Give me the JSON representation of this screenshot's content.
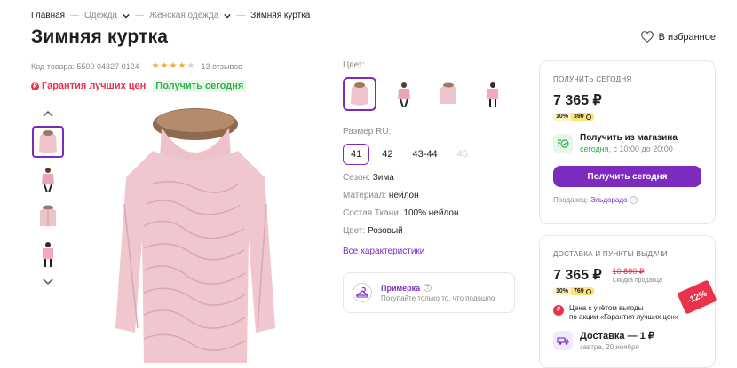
{
  "breadcrumb": {
    "items": [
      "Главная",
      "Одежда",
      "Женская одежда",
      "Зимняя куртка"
    ]
  },
  "product": {
    "title": "Зимняя куртка",
    "code": "Код товара: 5500 04327 0124",
    "rating": 4,
    "reviews": "13 отзывов",
    "favorite_label": "В избранное"
  },
  "badges": {
    "guarantee": "Гарантия лучших цен",
    "today": "Получить сегодня"
  },
  "gallery": {
    "thumbnails": [
      "jacket-back",
      "model-front",
      "jacket-front",
      "model-side"
    ],
    "selected_index": 0
  },
  "attributes": {
    "color_label": "Цвет:",
    "color_swatches": [
      "jacket-back",
      "model-front",
      "jacket-front",
      "model-side"
    ],
    "size_label": "Размер RU:",
    "sizes": [
      "41",
      "42",
      "43-44",
      "45"
    ],
    "selected_size": "41",
    "unavailable_size": "45",
    "specs": [
      {
        "key": "Сезон:",
        "value": "Зима"
      },
      {
        "key": "Материал:",
        "value": "нейлон"
      },
      {
        "key": "Состав Ткани:",
        "value": "100% нейлон"
      },
      {
        "key": "Цвет:",
        "value": "Розовый"
      }
    ],
    "all_chars": "Все характеристики"
  },
  "fitting": {
    "title": "Примерка",
    "subtitle": "Покупайте только то, что подошло"
  },
  "card_today": {
    "header": "ПОЛУЧИТЬ СЕГОДНЯ",
    "price": "7 365 ₽",
    "bonus_pct": "10%",
    "bonus_value": "390",
    "pickup_title": "Получить из магазина",
    "pickup_when": "сегодня",
    "pickup_time": ", с 10:00 до 20:00",
    "cta": "Получить сегодня",
    "seller_label": "Продавец:",
    "seller_name": "Эльдорадо"
  },
  "card_delivery": {
    "header": "ДОСТАВКА И ПУНКТЫ ВЫДАЧИ",
    "price": "7 365 ₽",
    "old_price": "10 890 ₽",
    "discount_label": "Скидка продавца",
    "bonus_pct": "10%",
    "bonus_value": "769",
    "promo_line1": "Цена с учётом выгоды",
    "promo_line2": "по акции «Гарантия лучших цен»",
    "ship_title": "Доставка — 1 ₽",
    "ship_sub": "завтра, 20 ноября",
    "discount_tag": "-12%"
  },
  "colors": {
    "accent": "#7b2cbf",
    "red": "#e9334a",
    "green": "#2fb34a",
    "jacket": "#efc3cb"
  }
}
